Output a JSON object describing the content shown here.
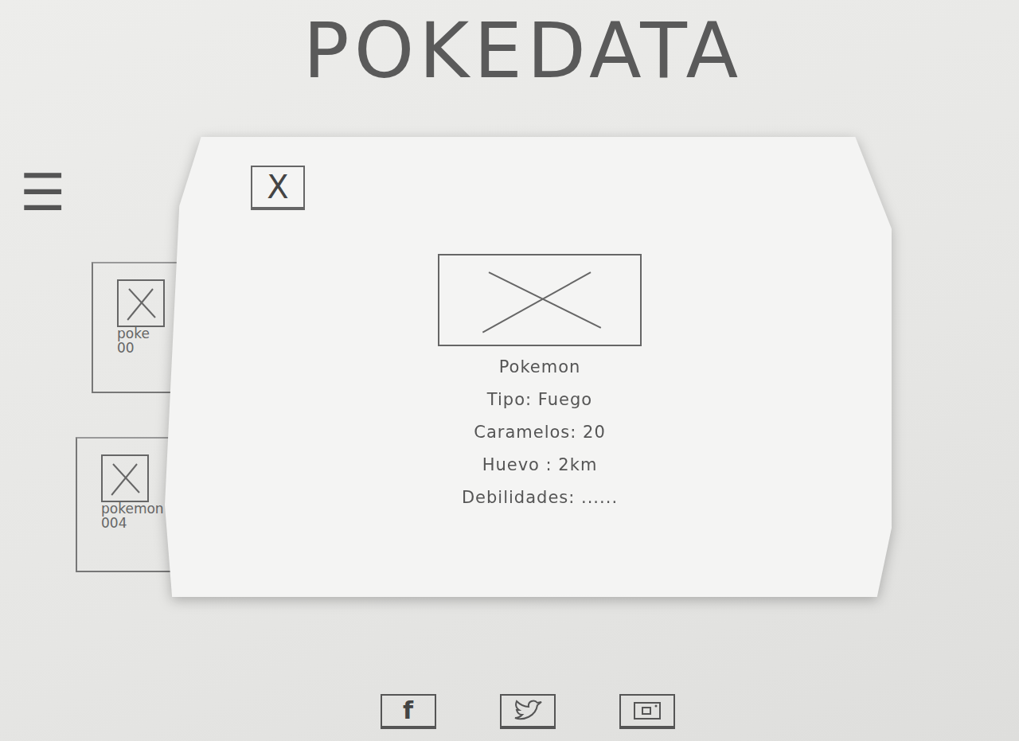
{
  "app": {
    "title": "POKEDATA",
    "menu_icon": "☰"
  },
  "cards": [
    {
      "name": "poke",
      "number": "00"
    },
    {
      "name": "pokemon",
      "number": "004"
    }
  ],
  "modal": {
    "close": "X",
    "name": "Pokemon",
    "fields": [
      "Tipo: Fuego",
      "Caramelos: 20",
      "Huevo : 2km",
      "Debilidades: ......"
    ]
  },
  "footer": {
    "social": [
      {
        "kind": "facebook",
        "glyph": "f"
      },
      {
        "kind": "twitter",
        "glyph": ""
      },
      {
        "kind": "instagram",
        "glyph": ""
      }
    ]
  }
}
